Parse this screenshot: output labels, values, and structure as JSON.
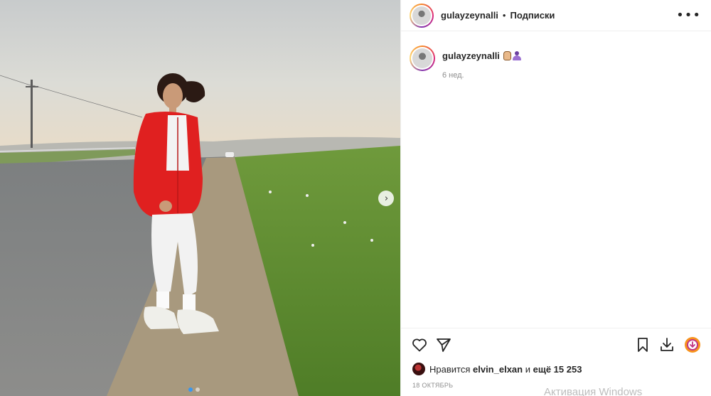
{
  "post": {
    "username": "gulayzeynalli",
    "separator": "•",
    "follow_label": "Подписки",
    "more_label": "•••",
    "caption_username": "gulayzeynalli",
    "caption_time": "6 нед.",
    "likes_prefix": "Нравится",
    "likes_user": "elvin_elxan",
    "likes_middle": "и",
    "likes_count": "ещё 15 253",
    "date": "18 ОКТЯБРЬ"
  },
  "carousel": {
    "next_label": "›",
    "total_slides": 2,
    "active_slide": 1
  },
  "icons": {
    "like": "heart-icon",
    "share": "send-icon",
    "save": "bookmark-icon",
    "download": "download-icon",
    "extension": "extension-icon"
  },
  "colors": {
    "accent": "#3897f0",
    "text": "#262626",
    "muted": "#8e8e8e",
    "jacket": "#e02020"
  },
  "watermark": "Активация Windows"
}
